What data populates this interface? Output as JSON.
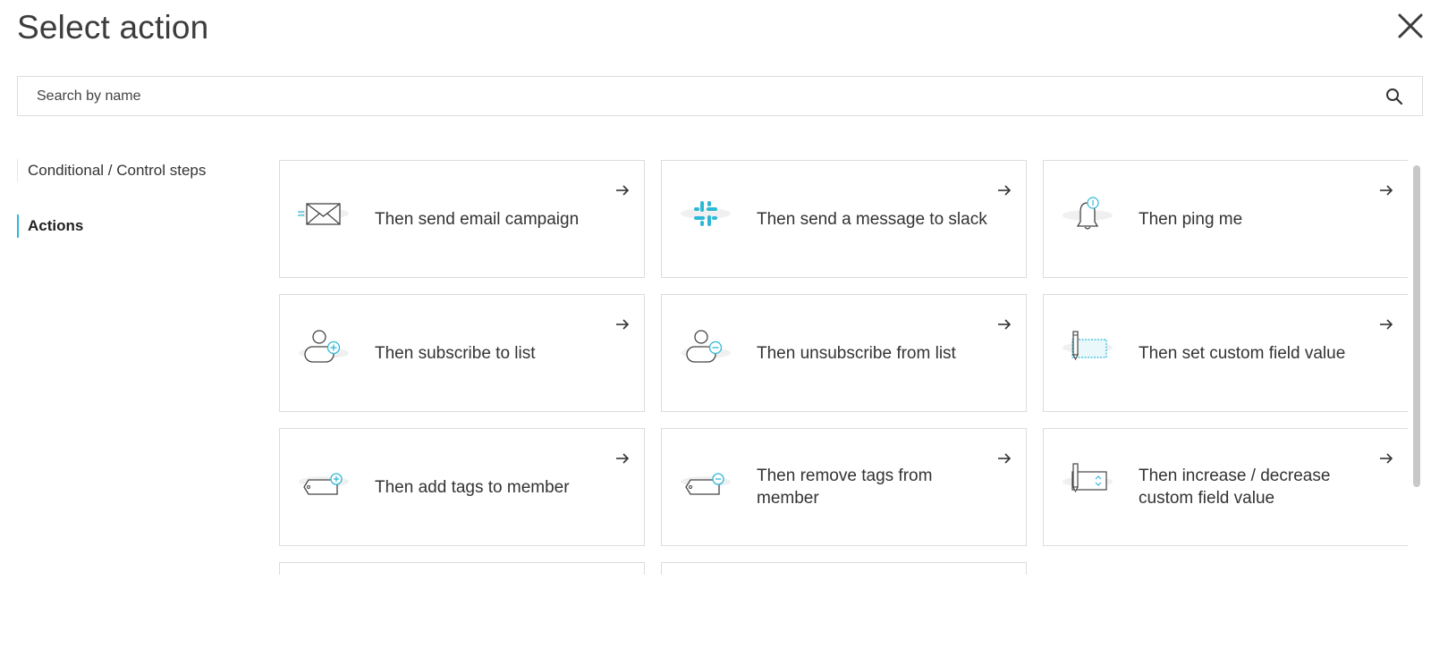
{
  "header": {
    "title": "Select action"
  },
  "search": {
    "placeholder": "Search by name",
    "value": ""
  },
  "sidebar": {
    "items": [
      {
        "label": "Conditional / Control steps",
        "active": false
      },
      {
        "label": "Actions",
        "active": true
      }
    ]
  },
  "cards": [
    {
      "label": "Then send email campaign",
      "icon": "envelope-icon"
    },
    {
      "label": "Then send a message to slack",
      "icon": "slack-icon"
    },
    {
      "label": "Then ping me",
      "icon": "bell-icon"
    },
    {
      "label": "Then subscribe to list",
      "icon": "user-plus-icon"
    },
    {
      "label": "Then unsubscribe from list",
      "icon": "user-minus-icon"
    },
    {
      "label": "Then set custom field value",
      "icon": "pen-field-icon"
    },
    {
      "label": "Then add tags to member",
      "icon": "tag-plus-icon"
    },
    {
      "label": "Then remove tags from member",
      "icon": "tag-minus-icon"
    },
    {
      "label": "Then increase / decrease custom field value",
      "icon": "field-updown-icon"
    }
  ],
  "colors": {
    "accent": "#2fb8d6",
    "border": "#dcdcdc",
    "text": "#333333"
  }
}
